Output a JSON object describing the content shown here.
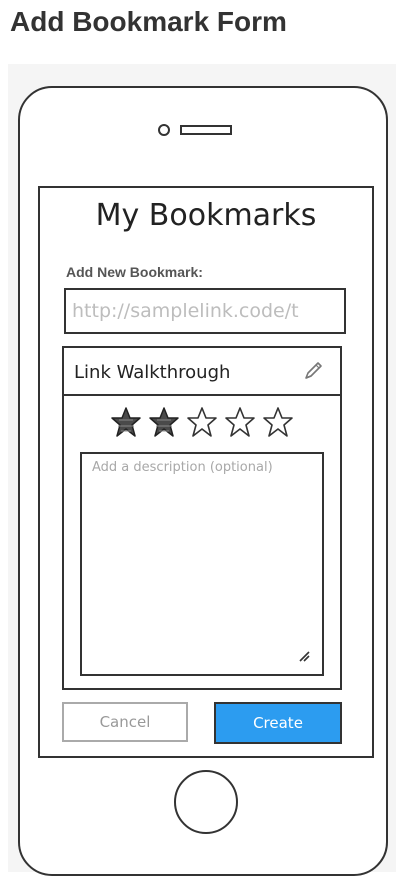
{
  "page": {
    "title": "Add Bookmark Form"
  },
  "app": {
    "title": "My Bookmarks"
  },
  "form": {
    "label": "Add New Bookmark:",
    "url_placeholder": "http://samplelink.code/t"
  },
  "card": {
    "title": "Link Walkthrough",
    "edit_icon": "pencil-icon",
    "rating": {
      "filled": 2,
      "total": 5
    },
    "description_placeholder": "Add a description (optional)"
  },
  "actions": {
    "cancel_label": "Cancel",
    "create_label": "Create"
  },
  "colors": {
    "accent": "#2c9cf0",
    "border": "#333333",
    "muted_text": "#999999",
    "placeholder_text": "#bdbdbd",
    "panel_bg": "#f5f5f5"
  }
}
